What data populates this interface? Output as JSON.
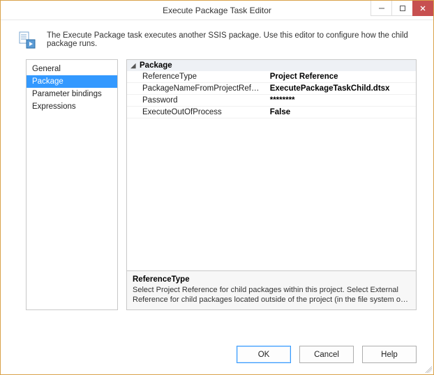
{
  "window": {
    "title": "Execute Package Task Editor"
  },
  "header": {
    "description": "The Execute Package task executes another SSIS package. Use this editor to configure how the child package runs."
  },
  "nav": {
    "items": [
      {
        "label": "General"
      },
      {
        "label": "Package"
      },
      {
        "label": "Parameter bindings"
      },
      {
        "label": "Expressions"
      }
    ],
    "selected_index": 1
  },
  "property_grid": {
    "category": "Package",
    "rows": [
      {
        "name": "ReferenceType",
        "value": "Project Reference"
      },
      {
        "name": "PackageNameFromProjectReference",
        "value": "ExecutePackageTaskChild.dtsx"
      },
      {
        "name": "Password",
        "value": "********"
      },
      {
        "name": "ExecuteOutOfProcess",
        "value": "False"
      }
    ]
  },
  "description_panel": {
    "title": "ReferenceType",
    "text": "Select Project Reference for child packages within this project. Select External Reference for child packages located outside of the project (in the file system or on an instance of SQL Se..."
  },
  "buttons": {
    "ok": "OK",
    "cancel": "Cancel",
    "help": "Help"
  }
}
